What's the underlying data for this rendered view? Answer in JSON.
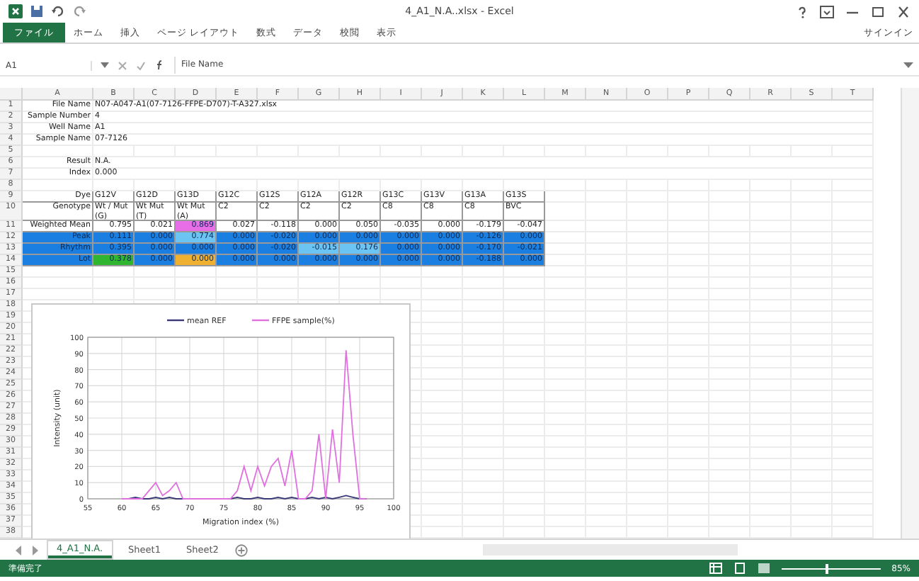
{
  "window": {
    "title": "4_A1_N.A..xlsx - Excel"
  },
  "ribbon": {
    "tabs": [
      {
        "label": "ファイル",
        "selected": true
      },
      {
        "label": "ホーム",
        "selected": false
      },
      {
        "label": "挿入",
        "selected": false
      },
      {
        "label": "ページ レイアウト",
        "selected": false
      },
      {
        "label": "数式",
        "selected": false
      },
      {
        "label": "データ",
        "selected": false
      },
      {
        "label": "校閲",
        "selected": false
      },
      {
        "label": "表示",
        "selected": false
      }
    ],
    "account": "サインイン"
  },
  "formula_bar": {
    "name_box": "A1",
    "formula": "File Name"
  },
  "sheet": {
    "column_headers": [
      "A",
      "B",
      "C",
      "D",
      "E",
      "F",
      "G",
      "H",
      "I",
      "J",
      "K",
      "L",
      "M",
      "N",
      "O",
      "P",
      "Q",
      "R",
      "S",
      "T"
    ],
    "rows": [
      {
        "number": "1",
        "kind": "info",
        "cells": [
          {
            "text": "File Name"
          },
          {
            "text": "N07-A047-A1(07-7126-FFPE-D707)-T-A327.xlsx"
          }
        ]
      },
      {
        "number": "2",
        "kind": "info",
        "cells": [
          {
            "text": "Sample Number"
          },
          {
            "text": "4"
          }
        ]
      },
      {
        "number": "3",
        "kind": "info",
        "cells": [
          {
            "text": "Well Name"
          },
          {
            "text": "A1"
          }
        ]
      },
      {
        "number": "4",
        "kind": "info",
        "cells": [
          {
            "text": "Sample Name"
          },
          {
            "text": "07-7126"
          }
        ]
      },
      {
        "number": "5",
        "cells": []
      },
      {
        "number": "6",
        "kind": "info",
        "cells": [
          {
            "text": "Result"
          },
          {
            "text": "N.A."
          }
        ]
      },
      {
        "number": "7",
        "kind": "info",
        "cells": [
          {
            "text": "Index"
          },
          {
            "text": "0.000"
          }
        ]
      },
      {
        "number": "8",
        "cells": []
      },
      {
        "number": "9",
        "kind": "labels",
        "cells": [
          {
            "text": "Dye"
          },
          {
            "text": "G12V"
          },
          {
            "text": "G12D"
          },
          {
            "text": "G13D"
          },
          {
            "text": "G12C"
          },
          {
            "text": "G12S"
          },
          {
            "text": "G12A"
          },
          {
            "text": "G12R"
          },
          {
            "text": "G13C"
          },
          {
            "text": "G13V"
          },
          {
            "text": "G13A"
          },
          {
            "text": "G13S"
          }
        ]
      },
      {
        "number": "10",
        "kind": "labels",
        "cells": [
          {
            "text": "Genotype"
          },
          {
            "text": "Wt / Mut (G)"
          },
          {
            "text": "Wt Mut (T)"
          },
          {
            "text": "Wt Mut (A)"
          },
          {
            "text": "C2"
          },
          {
            "text": "C2"
          },
          {
            "text": "C2"
          },
          {
            "text": "C2"
          },
          {
            "text": "C8"
          },
          {
            "text": "C8"
          },
          {
            "text": "C8"
          },
          {
            "text": "BVC"
          }
        ]
      },
      {
        "number": "11",
        "kind": "numbers",
        "cells": [
          {
            "text": "Weighted Mean"
          },
          {
            "text": "0.795"
          },
          {
            "text": "0.021"
          },
          {
            "text": "0.869",
            "color": "#e86ee8"
          },
          {
            "text": "0.027"
          },
          {
            "text": "-0.118"
          },
          {
            "text": "0.000"
          },
          {
            "text": "0.050"
          },
          {
            "text": "-0.035"
          },
          {
            "text": "0.000"
          },
          {
            "text": "-0.179"
          },
          {
            "text": "-0.047"
          }
        ]
      },
      {
        "number": "12",
        "kind": "numbers",
        "cells": [
          {
            "text": "Peak",
            "color": "#1a7fe0"
          },
          {
            "text": "0.111",
            "color": "#1a7fe0"
          },
          {
            "text": "0.000",
            "color": "#1a7fe0"
          },
          {
            "text": "0.774",
            "color": "#6cc4f2"
          },
          {
            "text": "0.000",
            "color": "#1a7fe0"
          },
          {
            "text": "-0.020",
            "color": "#1a7fe0"
          },
          {
            "text": "0.000",
            "color": "#1a7fe0"
          },
          {
            "text": "0.000",
            "color": "#1a7fe0"
          },
          {
            "text": "0.000",
            "color": "#1a7fe0"
          },
          {
            "text": "0.000",
            "color": "#1a7fe0"
          },
          {
            "text": "-0.126",
            "color": "#1a7fe0"
          },
          {
            "text": "0.000",
            "color": "#1a7fe0"
          }
        ]
      },
      {
        "number": "13",
        "kind": "numbers",
        "cells": [
          {
            "text": "Rhythm",
            "color": "#1a7fe0"
          },
          {
            "text": "0.395",
            "color": "#1a7fe0"
          },
          {
            "text": "0.000",
            "color": "#1a7fe0"
          },
          {
            "text": "0.000",
            "color": "#1a7fe0"
          },
          {
            "text": "0.000",
            "color": "#1a7fe0"
          },
          {
            "text": "-0.020",
            "color": "#1a7fe0"
          },
          {
            "text": "-0.015",
            "color": "#6cc4f2"
          },
          {
            "text": "0.176",
            "color": "#6cc4f2"
          },
          {
            "text": "0.000",
            "color": "#1a7fe0"
          },
          {
            "text": "0.000",
            "color": "#1a7fe0"
          },
          {
            "text": "-0.170",
            "color": "#1a7fe0"
          },
          {
            "text": "-0.021",
            "color": "#1a7fe0"
          }
        ]
      },
      {
        "number": "14",
        "kind": "numbers",
        "cells": [
          {
            "text": "Lot",
            "color": "#1a7fe0"
          },
          {
            "text": "0.378",
            "color": "#2fb52f"
          },
          {
            "text": "0.000",
            "color": "#1a7fe0"
          },
          {
            "text": "0.000",
            "color": "#f0b030"
          },
          {
            "text": "0.000",
            "color": "#1a7fe0"
          },
          {
            "text": "0.000",
            "color": "#1a7fe0"
          },
          {
            "text": "0.000",
            "color": "#1a7fe0"
          },
          {
            "text": "0.000",
            "color": "#1a7fe0"
          },
          {
            "text": "0.000",
            "color": "#1a7fe0"
          },
          {
            "text": "0.000",
            "color": "#1a7fe0"
          },
          {
            "text": "-0.188",
            "color": "#1a7fe0"
          },
          {
            "text": "0.000",
            "color": "#1a7fe0"
          }
        ]
      },
      {
        "number": "15",
        "cells": []
      },
      {
        "number": "16",
        "cells": []
      },
      {
        "number": "17",
        "cells": []
      },
      {
        "number": "18",
        "cells": []
      },
      {
        "number": "19",
        "cells": []
      },
      {
        "number": "20",
        "cells": []
      },
      {
        "number": "21",
        "cells": []
      },
      {
        "number": "22",
        "cells": []
      },
      {
        "number": "23",
        "cells": []
      },
      {
        "number": "24",
        "cells": []
      },
      {
        "number": "25",
        "cells": []
      },
      {
        "number": "26",
        "cells": []
      },
      {
        "number": "27",
        "cells": []
      },
      {
        "number": "28",
        "cells": []
      },
      {
        "number": "29",
        "cells": []
      },
      {
        "number": "30",
        "cells": []
      },
      {
        "number": "31",
        "cells": []
      },
      {
        "number": "32",
        "cells": []
      },
      {
        "number": "33",
        "cells": []
      },
      {
        "number": "34",
        "cells": []
      },
      {
        "number": "35",
        "cells": []
      },
      {
        "number": "36",
        "cells": []
      },
      {
        "number": "37",
        "cells": []
      },
      {
        "number": "38",
        "cells": []
      }
    ],
    "chart": {
      "chart_data": {
        "type": "line",
        "xlabel": "Migration index (%)",
        "ylabel": "Intensity (unit)",
        "x": [
          60,
          61,
          62,
          63,
          64,
          65,
          66,
          67,
          68,
          69,
          70,
          71,
          72,
          73,
          74,
          75,
          76,
          77,
          78,
          79,
          80,
          81,
          82,
          83,
          84,
          85,
          86,
          87,
          88,
          89,
          90,
          91,
          92,
          93,
          94,
          95,
          96
        ],
        "series": [
          {
            "name": "mean REF",
            "color": "#3a3a7a",
            "values": [
              0,
              0,
              1,
              0,
              0,
              1,
              0,
              1,
              0,
              0,
              0,
              0,
              0,
              0,
              0,
              0,
              0,
              1,
              0,
              0,
              1,
              0,
              0,
              1,
              0,
              1,
              0,
              0,
              1,
              0,
              1,
              0,
              1,
              2,
              1,
              0,
              0
            ]
          },
          {
            "name": "FFPE sample(%)",
            "color": "#e070e0",
            "values": [
              0,
              0,
              0,
              0,
              5,
              10,
              2,
              5,
              10,
              0,
              0,
              0,
              0,
              0,
              0,
              0,
              0,
              5,
              20,
              5,
              20,
              8,
              20,
              25,
              8,
              30,
              0,
              0,
              5,
              40,
              0,
              43,
              10,
              92,
              40,
              0,
              0
            ]
          }
        ],
        "grid": true,
        "legend": "top",
        "xlim": [
          55,
          100
        ],
        "ylim": [
          0,
          100
        ],
        "xticks": [
          55,
          60,
          65,
          70,
          75,
          80,
          85,
          90,
          95,
          100
        ],
        "yticks": [
          0,
          10,
          20,
          30,
          40,
          50,
          60,
          70,
          80,
          90,
          100
        ]
      }
    }
  },
  "sheet_tabs": [
    {
      "label": "4_A1_N.A.",
      "selected": true
    },
    {
      "label": "Sheet1",
      "selected": false
    },
    {
      "label": "Sheet2",
      "selected": false
    }
  ],
  "status_bar": {
    "status": "準備完了",
    "zoom": "85%",
    "zoom_slider": {
      "level": 0.45
    }
  }
}
